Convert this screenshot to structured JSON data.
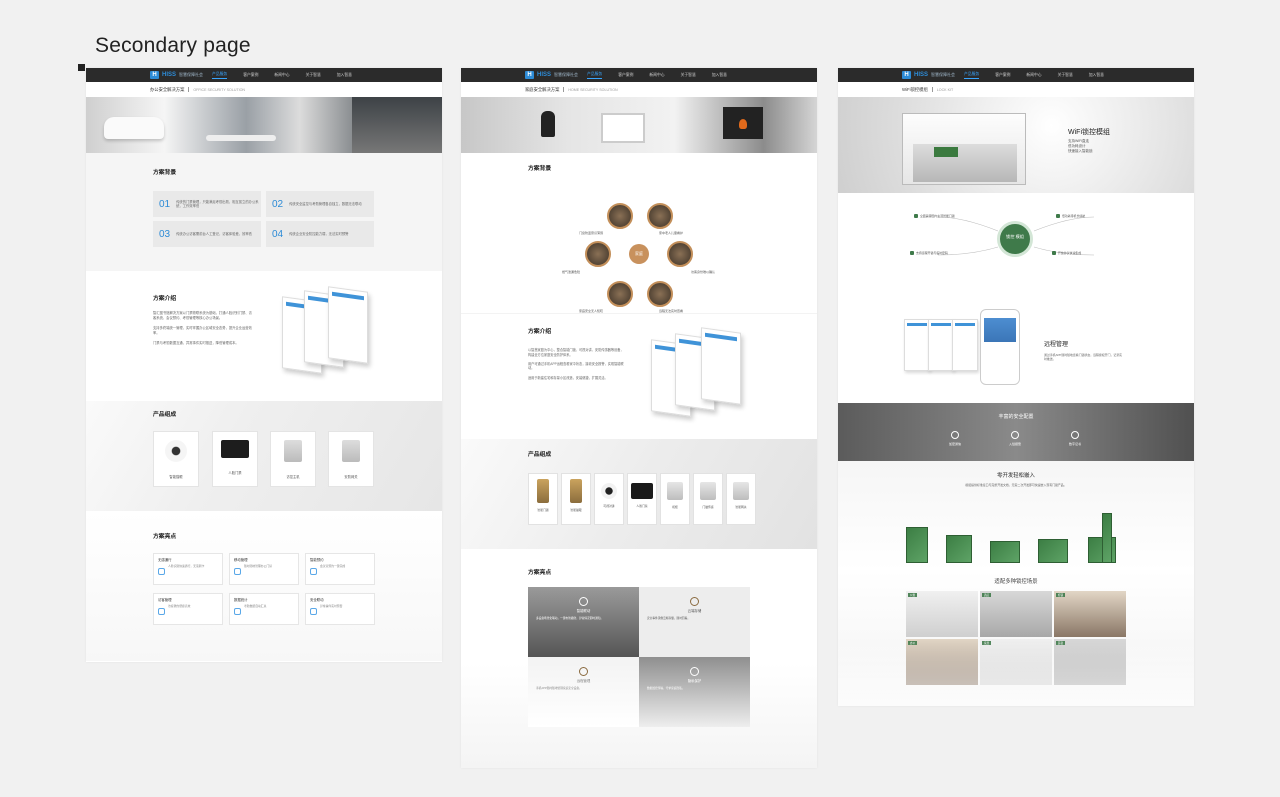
{
  "page": {
    "heading": "Secondary page"
  },
  "nav": {
    "logo_mark": "H",
    "logo_text": "HISS",
    "logo_sub": "智慧保障社会",
    "items": [
      "产品服务",
      "客户案例",
      "新闻中心",
      "关于智慧",
      "加入智慧"
    ]
  },
  "col1": {
    "crumb_cn": "办公安全解决方案",
    "crumb_en": "OFFICE SECURITY SOLUTION",
    "bg_title": "方案背景",
    "bg_cards": [
      {
        "n": "01",
        "t": "传统的门禁管理，只能满足考勤出勤，相互孤立的办公系统，工作效率低"
      },
      {
        "n": "02",
        "t": "传统安全监控与考勤管理各自独立，数据无法联动"
      },
      {
        "n": "03",
        "t": "传统办公访客需前台人工登记，访客体验差，效率低"
      },
      {
        "n": "04",
        "t": "传统企业安全防控能力弱，无法实时预警"
      }
    ],
    "intro_title": "方案介绍",
    "intro_paras": [
      "智汇图书馆解决方案以门禁物联系统为基础，打通人脸识别门禁、访客系统、会议预约、考勤管理等核心办公场景。",
      "支持多终端统一管理，实时掌握办公区域安全态势，提升企业运营效率。",
      "门禁与考勤数据互通，异常事件实时推送，降低管理成本。"
    ],
    "prod_title": "产品组成",
    "products": [
      "智能猫眼",
      "人脸门禁",
      "访控主机",
      "安防网关"
    ],
    "hl_title": "方案亮点",
    "highlights": [
      {
        "h": "无感通行",
        "b": "人脸识别快速通行，无需刷卡"
      },
      {
        "h": "移动管理",
        "b": "随时随地管理办公门禁"
      },
      {
        "h": "智能预约",
        "b": "会议室预约一键完成"
      },
      {
        "h": "访客管理",
        "b": "访客邀约便捷高效"
      },
      {
        "h": "数据统计",
        "b": "考勤数据自动汇总"
      },
      {
        "h": "安全联动",
        "b": "异常事件实时预警"
      }
    ]
  },
  "col2": {
    "crumb_cn": "家庭安全解决方案",
    "crumb_en": "HOME SECURITY SOLUTION",
    "bg_title": "方案背景",
    "bg_center": "家庭",
    "bg_items": [
      "门窗防盗意识薄弱",
      "家中老人儿童看护",
      "燃气泄漏危险",
      "访客身份难以确认",
      "家庭安全无人知晓",
      "远程无法实时查看"
    ],
    "intro_title": "方案介绍",
    "intro_paras": [
      "以智慧家庭为中心，整合智能门锁、可视对讲、安防传感器等设备，构建全方位家庭安全防护体系。",
      "用户可通过手机APP远程查看家中状态，接收安全报警，实现智能联动。",
      "适用于新建住宅和存量小区改造，安装便捷，扩展灵活。"
    ],
    "prod_title": "产品组成",
    "products": [
      "智能门锁",
      "智能猫眼",
      "可视对讲",
      "人脸门禁",
      "机柜",
      "门磁传感",
      "智能网关"
    ],
    "hl_title": "方案亮点",
    "tiles": [
      {
        "h": "智能联动",
        "b": "多设备场景化联动，一键布防撤防，异常情况即时通知。"
      },
      {
        "h": "云端存储",
        "b": "安全事件录像云端存储，随时回看。"
      },
      {
        "h": "远程管理",
        "b": "手机APP随时随地管理家庭安全设备。"
      },
      {
        "h": "隐私保护",
        "b": "数据加密传输，守护家庭隐私。"
      }
    ]
  },
  "col3": {
    "crumb_cn": "WiFi锁控模组",
    "crumb_en": "LOCK KIT",
    "banner_title": "WiFi锁控模组",
    "banner_lines": [
      "支持WiFi直连",
      "低功耗设计",
      "快速接入智能锁"
    ],
    "module_center": "锁控 模组",
    "features": [
      "全面兼容国内主流智能门锁",
      "支持远程开锁与临时密码",
      "低功耗待机长续航",
      "开放协议快速集成"
    ],
    "remote_title": "远程管理",
    "remote_text": "通过手机APP随时随地查看门锁状态，远程授权开门，记录实时推送。",
    "security_title": "丰富的安全配置",
    "security_items": [
      "加密通信",
      "入侵报警",
      "数字证书"
    ],
    "embed_title": "零开发轻松嵌入",
    "embed_text": "模组提供标准接口与完整开发文档，无需二次开发即可快速嵌入现有门锁产品。",
    "scene_title": "适配多种锁控场景",
    "scenes": [
      "公寓",
      "酒店",
      "柜锁",
      "办公",
      "家居",
      "民宿"
    ]
  }
}
